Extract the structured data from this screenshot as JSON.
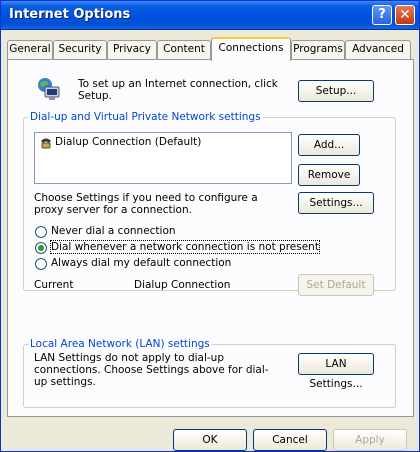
{
  "window": {
    "title": "Internet Options"
  },
  "titlebar_buttons": {
    "help": "?",
    "close": "✕"
  },
  "tabs": [
    "General",
    "Security",
    "Privacy",
    "Content",
    "Connections",
    "Programs",
    "Advanced"
  ],
  "active_tab": "Connections",
  "setup": {
    "text": "To set up an Internet connection, click Setup.",
    "button": "Setup..."
  },
  "dialup_group": {
    "label": "Dial-up and Virtual Private Network settings",
    "connections": [
      "Dialup Connection (Default)"
    ],
    "add_button": "Add...",
    "remove_button": "Remove",
    "proxy_text": "Choose Settings if you need to configure a proxy server for a connection.",
    "settings_button": "Settings...",
    "options": [
      {
        "label": "Never dial a connection",
        "checked": false
      },
      {
        "label": "Dial whenever a network connection is not present",
        "checked": true
      },
      {
        "label": "Always dial my default connection",
        "checked": false
      }
    ],
    "current_label": "Current",
    "current_value": "Dialup Connection",
    "set_default_button": "Set Default"
  },
  "lan_group": {
    "label": "Local Area Network (LAN) settings",
    "text": "LAN Settings do not apply to dial-up connections. Choose Settings above for dial-up settings.",
    "button": "LAN Settings..."
  },
  "footer": {
    "ok": "OK",
    "cancel": "Cancel",
    "apply": "Apply"
  }
}
